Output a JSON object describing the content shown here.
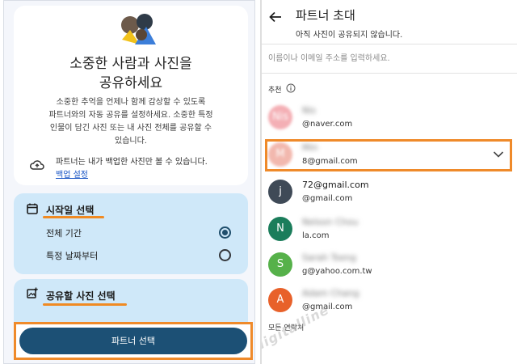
{
  "left": {
    "hero_title": "소중한 사람과 사진을\n공유하세요",
    "hero_desc": "소중한 추억을 언제나 함께 감상할 수 있도록\n파트너와의 자동 공유를 설정하세요. 소중한 특정\n인물이 담긴 사진 또는 내 사진 전체를 공유할 수\n있습니다.",
    "notice_text": "파트너는 내가 백업한 사진만 볼 수 있습니다.",
    "backup_link": "백업 설정",
    "start_section_title": "시작일 선택",
    "options": [
      {
        "label": "전체 기간",
        "selected": true
      },
      {
        "label": "특정 날짜부터",
        "selected": false
      }
    ],
    "share_section_title": "공유할 사진 선택",
    "partner_button": "파트너 선택"
  },
  "right": {
    "title": "파트너 초대",
    "subtitle": "아직 사진이 공유되지 않습니다.",
    "search_placeholder": "이름이나 이메일 주소를 입력하세요.",
    "recommend_label": "추천",
    "all_contacts_label": "모든 연락처",
    "contacts": [
      {
        "initial": "Nis",
        "name": "Nis",
        "email": "@naver.com",
        "color": "#f3a7ad"
      },
      {
        "initial": "M",
        "name": "Min",
        "email": "8@gmail.com",
        "color": "#f1b1a6"
      },
      {
        "initial": "j",
        "name": "72@gmail.com",
        "email": "@gmail.com",
        "color": "#3f4a57"
      },
      {
        "initial": "N",
        "name": "Nelson Chou",
        "email": "la.com",
        "color": "#1b7d5b"
      },
      {
        "initial": "S",
        "name": "Sarah Tseng",
        "email": "g@yahoo.com.tw",
        "color": "#56b14a"
      },
      {
        "initial": "A",
        "name": "Adam Chang",
        "email": "@gmail.com",
        "color": "#e8612a"
      }
    ],
    "watermark": "digitalline"
  }
}
